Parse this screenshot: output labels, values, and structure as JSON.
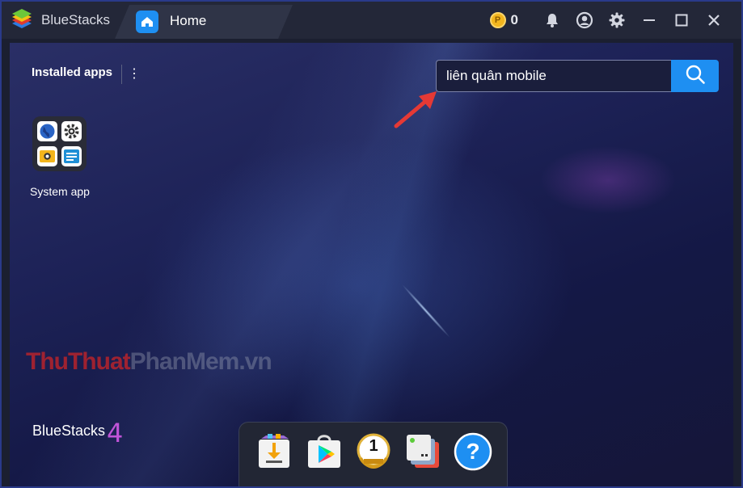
{
  "titlebar": {
    "app_name": "BlueStacks",
    "tab_label": "Home",
    "coins": "0",
    "coin_symbol": "P",
    "icons": [
      "bell-icon",
      "account-icon",
      "gear-icon",
      "minimize-icon",
      "maximize-icon",
      "close-icon"
    ]
  },
  "home": {
    "installed_label": "Installed apps",
    "menu_glyph": "⋮",
    "search_value": "liên quân mobile",
    "apps": [
      {
        "label": "System app"
      }
    ]
  },
  "watermark": {
    "part1": "ThuThuat",
    "part2": "PhanMem",
    "part3": ".vn"
  },
  "branding": {
    "name": "BlueStacks",
    "version": "4"
  },
  "dock": {
    "items": [
      "download-app-icon",
      "play-store-icon",
      "leaderboard-icon",
      "multi-instance-icon",
      "help-icon"
    ],
    "leaderboard_number": "1",
    "help_glyph": "?"
  },
  "colors": {
    "accent": "#1e8ff2",
    "annotation_arrow": "#e53935",
    "coin": "#f2b51d"
  }
}
